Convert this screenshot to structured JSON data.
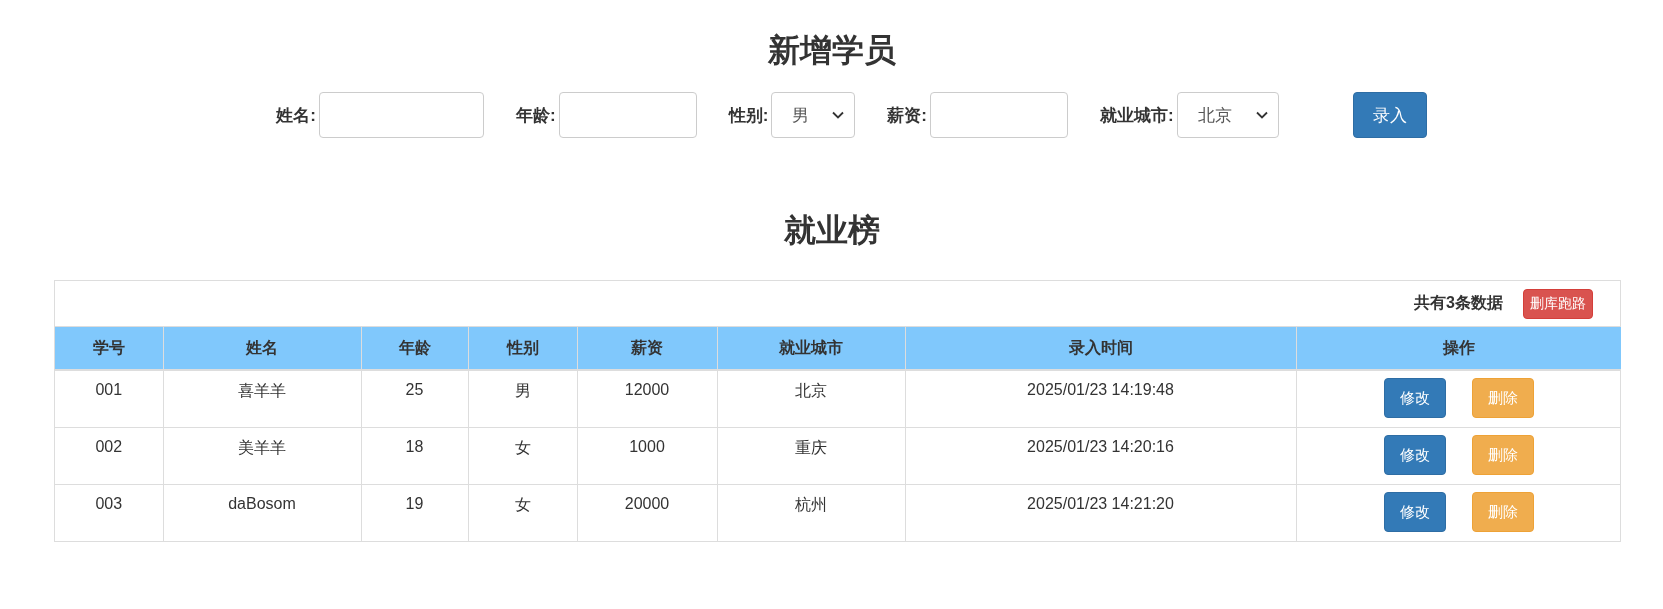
{
  "form": {
    "title": "新增学员",
    "fields": [
      {
        "kind": "input",
        "label": "姓名:"
      },
      {
        "kind": "input",
        "label": "年龄:"
      },
      {
        "kind": "select",
        "label": "性别:",
        "value": "男"
      },
      {
        "kind": "input",
        "label": "薪资:"
      },
      {
        "kind": "select",
        "label": "就业城市:",
        "value": "北京"
      }
    ],
    "submit": "录入"
  },
  "board": {
    "title": "就业榜",
    "summary": "共有3条数据",
    "clear_button": "删库跑路",
    "columns": [
      "学号",
      "姓名",
      "年龄",
      "性别",
      "薪资",
      "就业城市",
      "录入时间",
      "操作"
    ],
    "rows": [
      {
        "cells": [
          "001",
          "喜羊羊",
          "25",
          "男",
          "12000",
          "北京",
          "2025/01/23 14:19:48"
        ],
        "edit": "修改",
        "delete": "删除"
      },
      {
        "cells": [
          "002",
          "美羊羊",
          "18",
          "女",
          "1000",
          "重庆",
          "2025/01/23 14:20:16"
        ],
        "edit": "修改",
        "delete": "删除"
      },
      {
        "cells": [
          "003",
          "daBosom",
          "19",
          "女",
          "20000",
          "杭州",
          "2025/01/23 14:21:20"
        ],
        "edit": "修改",
        "delete": "删除"
      }
    ]
  }
}
